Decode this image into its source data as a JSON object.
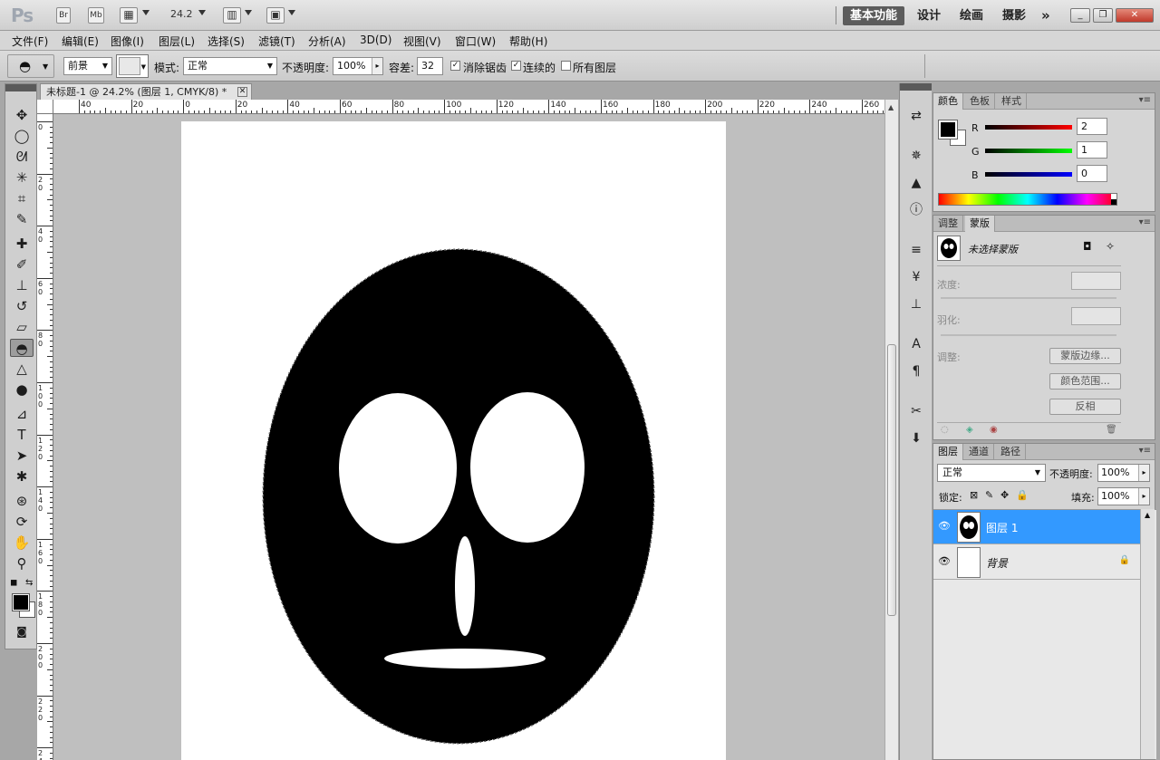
{
  "appbar": {
    "logo": "Ps",
    "br": "Br",
    "mb": "Mb",
    "zoom": "24.2",
    "workspaces": [
      "基本功能",
      "设计",
      "绘画",
      "摄影"
    ],
    "more": "»"
  },
  "menu": [
    "文件(F)",
    "编辑(E)",
    "图像(I)",
    "图层(L)",
    "选择(S)",
    "滤镜(T)",
    "分析(A)",
    "3D(D)",
    "视图(V)",
    "窗口(W)",
    "帮助(H)"
  ],
  "options": {
    "fill_source": "前景",
    "mode_label": "模式:",
    "mode_value": "正常",
    "opacity_label": "不透明度:",
    "opacity_value": "100%",
    "tolerance_label": "容差:",
    "tolerance_value": "32",
    "antialias": "消除锯齿",
    "contiguous": "连续的",
    "all_layers": "所有图层"
  },
  "document": {
    "tab_title": "未标题-1 @ 24.2% (图层 1, CMYK/8) *",
    "ruler_top": [
      "40",
      "20",
      "0",
      "20",
      "40",
      "60",
      "80",
      "100",
      "120",
      "140",
      "160",
      "180",
      "200",
      "220",
      "240",
      "260"
    ],
    "ruler_left": [
      "0",
      "2 0",
      "4 0",
      "6 0",
      "8 0",
      "1 0 0",
      "1 2 0",
      "1 4 0",
      "1 6 0",
      "1 8 0",
      "2 0 0",
      "2 2 0",
      "2 4"
    ]
  },
  "color_panel": {
    "tabs": [
      "颜色",
      "色板",
      "样式"
    ],
    "r_label": "R",
    "r_value": "2",
    "g_label": "G",
    "g_value": "1",
    "b_label": "B",
    "b_value": "0"
  },
  "mask_panel": {
    "tabs": [
      "调整",
      "蒙版"
    ],
    "title": "未选择蒙版",
    "density": "浓度:",
    "feather": "羽化:",
    "refine": "调整:",
    "btn_edge": "蒙版边缘...",
    "btn_range": "颜色范围...",
    "btn_invert": "反相"
  },
  "layers_panel": {
    "tabs": [
      "图层",
      "通道",
      "路径"
    ],
    "blend": "正常",
    "opacity_label": "不透明度:",
    "opacity_value": "100%",
    "lock_label": "锁定:",
    "fill_label": "填充:",
    "fill_value": "100%",
    "layers": [
      {
        "name": "图层 1"
      },
      {
        "name": "背景"
      }
    ]
  },
  "colors": {
    "selected_layer": "#3399ff",
    "foreground": "#000000",
    "background": "#ffffff"
  }
}
